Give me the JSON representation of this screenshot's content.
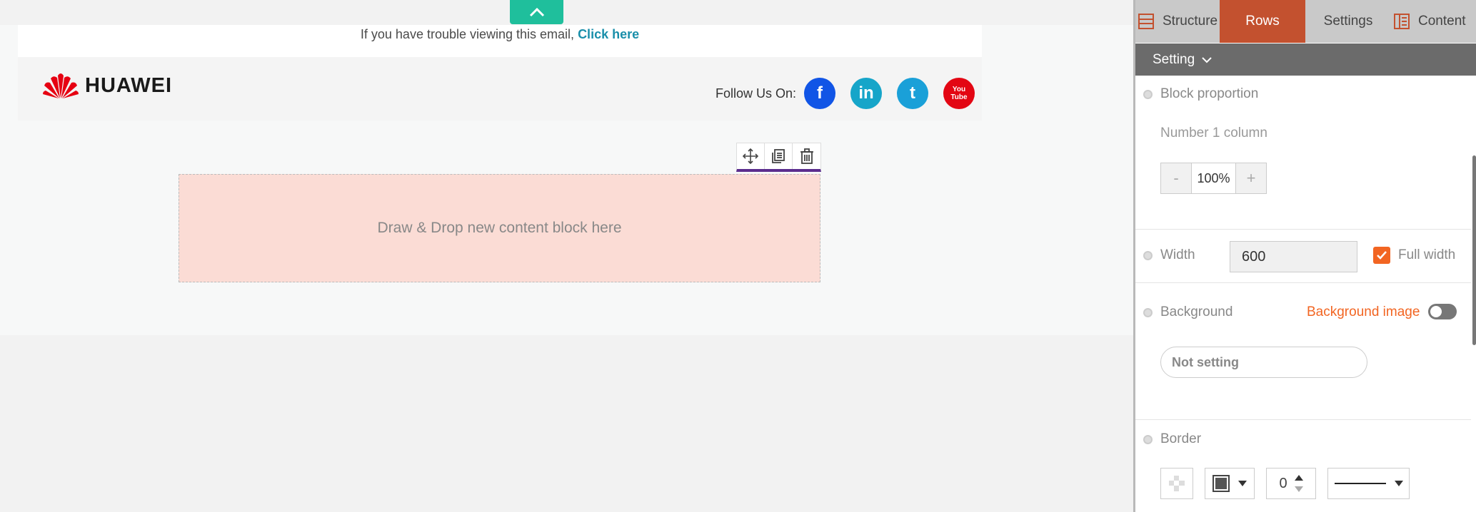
{
  "email": {
    "trouble_text": "If you have trouble viewing this email,",
    "trouble_link": "Click here",
    "brand": "HUAWEI",
    "follow_label": "Follow Us On:",
    "social": [
      "f",
      "in",
      "t",
      "You Tube"
    ],
    "drop_zone": "Draw & Drop new content block here"
  },
  "icons": [
    "chevron-up-icon",
    "move-icon",
    "duplicate-icon",
    "trash-icon",
    "structure-icon",
    "content-icon",
    "chevron-down-icon",
    "check-icon"
  ],
  "colors": {
    "accent": "#c3512f",
    "teal": "#1fbf9c",
    "orange": "#f26522",
    "drop_zone_bg": "#fbdcd5",
    "facebook": "#1155e6",
    "linkedin": "#16a5c9",
    "twitter": "#1aa0d8",
    "youtube": "#e30613"
  },
  "panel": {
    "tabs": {
      "structure": "Structure",
      "rows": "Rows",
      "settings": "Settings",
      "content": "Content"
    },
    "setting_bar": "Setting",
    "block_proportion": "Block proportion",
    "column_count": "Number 1 column",
    "stepper": {
      "minus": "-",
      "value": "100%",
      "plus": "+"
    },
    "width_label": "Width",
    "width_value": "600",
    "full_width": "Full width",
    "background_label": "Background",
    "background_image": "Background image",
    "background_select": "Not setting",
    "border_label": "Border",
    "border_width": "0"
  }
}
